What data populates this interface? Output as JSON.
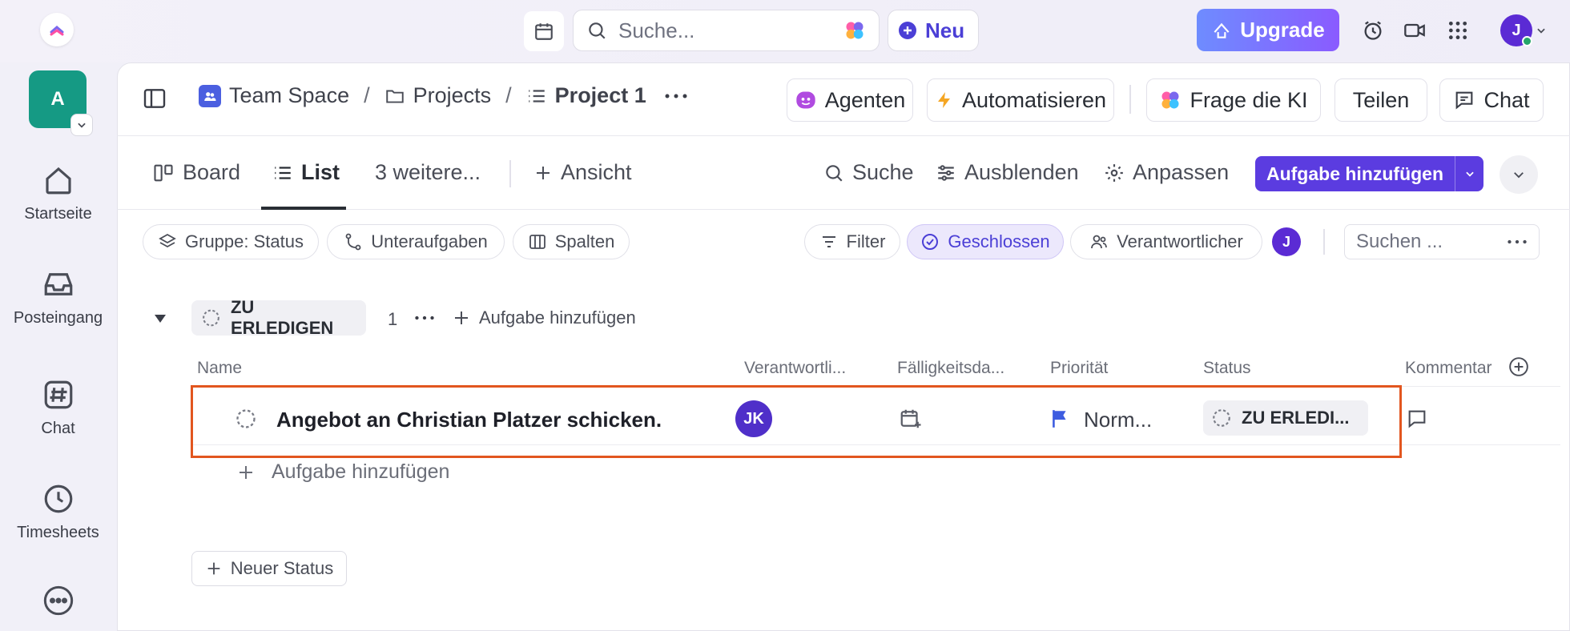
{
  "topbar": {
    "search_placeholder": "Suche...",
    "new_label": "Neu",
    "upgrade_label": "Upgrade",
    "user_initial": "J"
  },
  "sidebar": {
    "workspace_initial": "A",
    "items": [
      {
        "label": "Startseite",
        "icon": "home-icon"
      },
      {
        "label": "Posteingang",
        "icon": "inbox-icon"
      },
      {
        "label": "Chat",
        "icon": "hash-icon"
      },
      {
        "label": "Timesheets",
        "icon": "clock-icon"
      }
    ]
  },
  "breadcrumb": {
    "space": "Team Space",
    "folder": "Projects",
    "list": "Project 1",
    "sep": "/"
  },
  "header_actions": {
    "agents": "Agenten",
    "automate": "Automatisieren",
    "ask_ai": "Frage die KI",
    "share": "Teilen",
    "chat": "Chat"
  },
  "views": {
    "board": "Board",
    "list": "List",
    "more": "3 weitere...",
    "add_view": "Ansicht",
    "search": "Suche",
    "hide": "Ausblenden",
    "customize": "Anpassen",
    "add_task": "Aufgabe hinzufügen"
  },
  "filters": {
    "group": "Gruppe: Status",
    "subtasks": "Unteraufgaben",
    "columns": "Spalten",
    "filter": "Filter",
    "closed": "Geschlossen",
    "assignee": "Verantwortlicher",
    "avatar_initial": "J",
    "search_placeholder": "Suchen ..."
  },
  "group": {
    "status": "ZU ERLEDIGEN",
    "count": "1",
    "add_task": "Aufgabe hinzufügen"
  },
  "columns": {
    "name": "Name",
    "assignee": "Verantwortli...",
    "due": "Fälligkeitsda...",
    "priority": "Priorität",
    "status": "Status",
    "comments": "Kommentar"
  },
  "task": {
    "name": "Angebot an Christian Platzer schicken.",
    "assignee_initials": "JK",
    "priority": "Norm...",
    "status": "ZU ERLEDI..."
  },
  "add_task_row": "Aufgabe hinzufügen",
  "new_status": "Neuer Status",
  "colors": {
    "accent": "#5b3ce0",
    "highlight": "#e2561f",
    "workspace": "#159a84",
    "priority_flag": "#3d5ce0"
  }
}
